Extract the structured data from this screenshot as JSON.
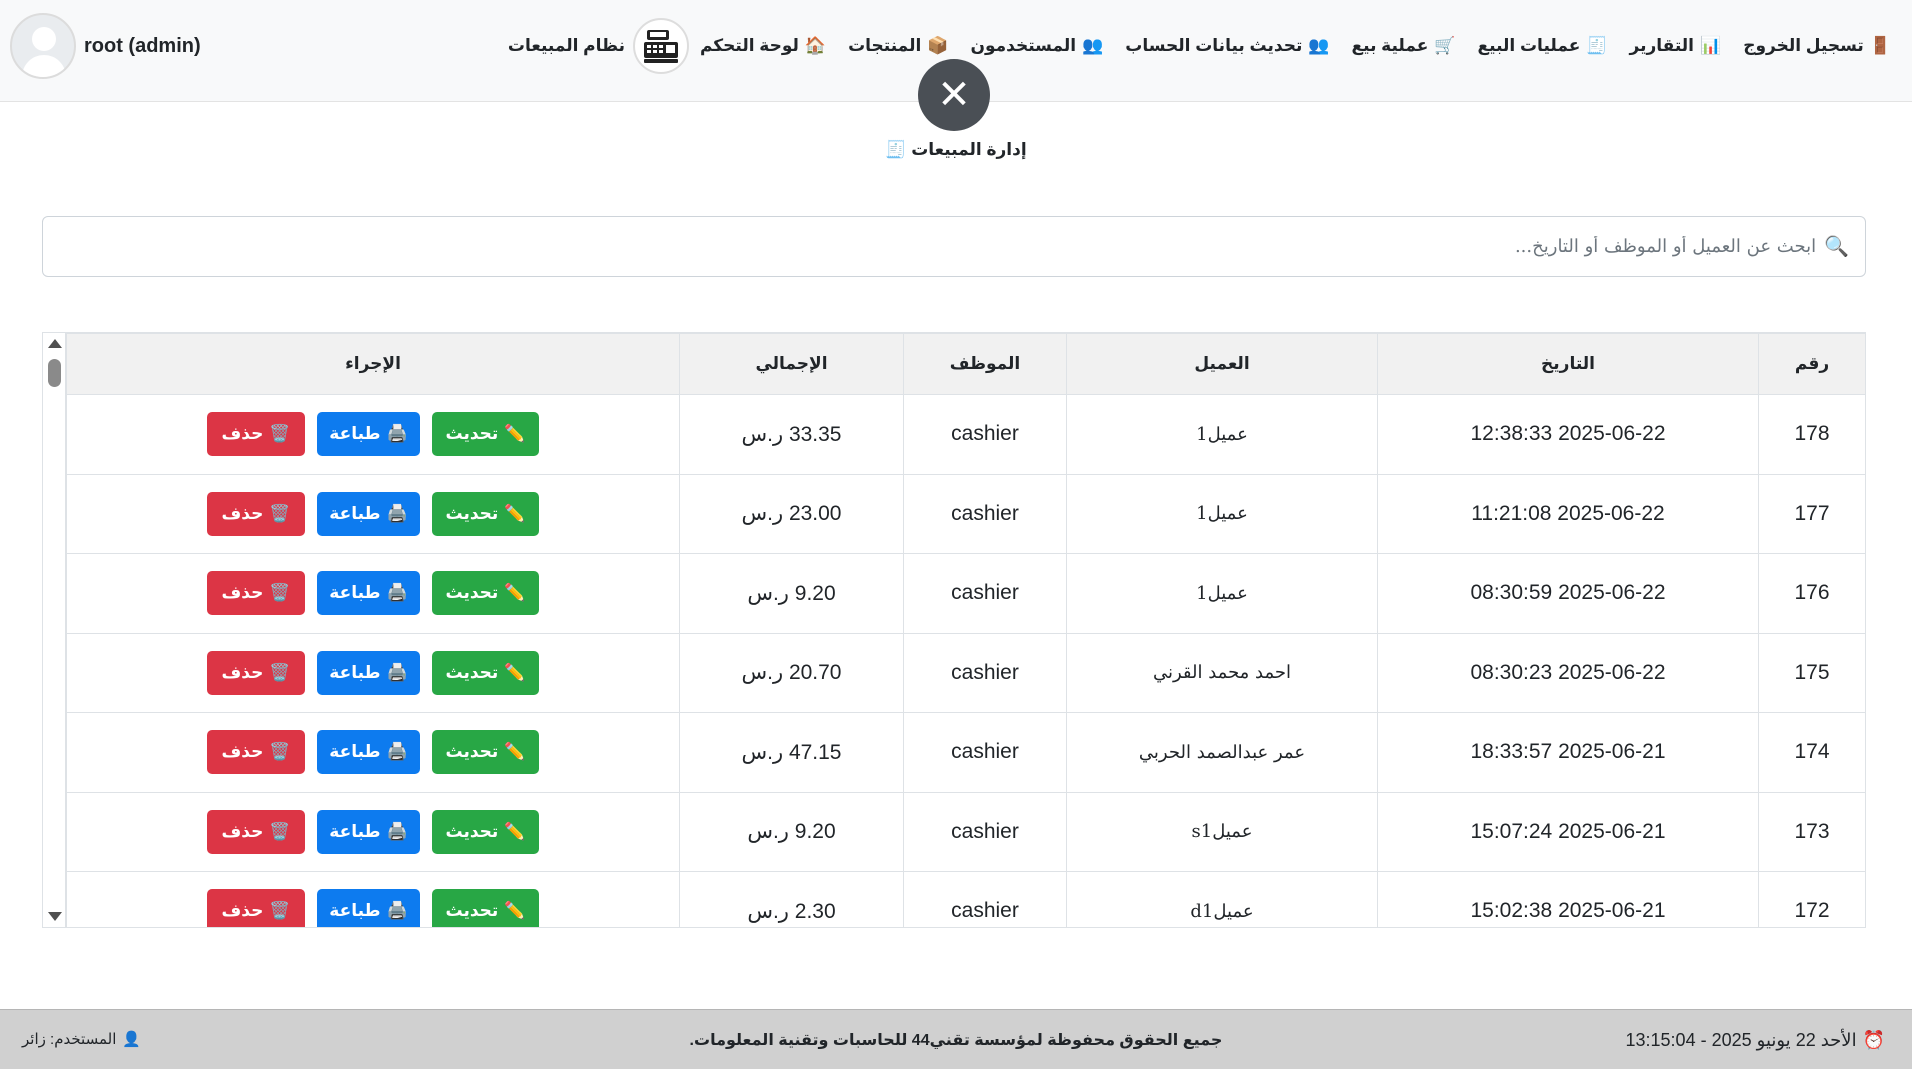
{
  "header": {
    "user_name": "root (admin)",
    "brand": "نظام المبيعات",
    "nav": [
      {
        "label": "لوحة التحكم",
        "icon": "🏠"
      },
      {
        "label": "المنتجات",
        "icon": "📦"
      },
      {
        "label": "المستخدمون",
        "icon": "👥"
      },
      {
        "label": "تحديث بيانات الحساب",
        "icon": "👥"
      },
      {
        "label": "عملية بيع",
        "icon": "🛒"
      },
      {
        "label": "عمليات البيع",
        "icon": "🧾"
      },
      {
        "label": "التقارير",
        "icon": "📊"
      },
      {
        "label": "تسجيل الخروج",
        "icon": "🚪"
      }
    ]
  },
  "close_symbol": "✕",
  "section": {
    "title": "إدارة المبيعات",
    "icon": "🧾"
  },
  "search": {
    "placeholder": "ابحث عن العميل أو الموظف أو التاريخ...",
    "icon": "🔍"
  },
  "table": {
    "headers": {
      "num": "رقم",
      "date": "التاريخ",
      "client": "العميل",
      "employee": "الموظف",
      "total": "الإجمالي",
      "action": "الإجراء"
    },
    "buttons": {
      "update": "تحديث",
      "print": "طباعة",
      "delete": "حذف",
      "update_icon": "✏️",
      "print_icon": "🖨️",
      "delete_icon": "🗑️"
    },
    "rows": [
      {
        "num": "178",
        "date": "2025-06-22 12:38:33",
        "client": "عميل1",
        "employee": "cashier",
        "total": "33.35 ر.س"
      },
      {
        "num": "177",
        "date": "2025-06-22 11:21:08",
        "client": "عميل1",
        "employee": "cashier",
        "total": "23.00 ر.س"
      },
      {
        "num": "176",
        "date": "2025-06-22 08:30:59",
        "client": "عميل1",
        "employee": "cashier",
        "total": "9.20 ر.س"
      },
      {
        "num": "175",
        "date": "2025-06-22 08:30:23",
        "client": "احمد محمد القرني",
        "employee": "cashier",
        "total": "20.70 ر.س"
      },
      {
        "num": "174",
        "date": "2025-06-21 18:33:57",
        "client": "عمر عبدالصمد الحربي",
        "employee": "cashier",
        "total": "47.15 ر.س"
      },
      {
        "num": "173",
        "date": "2025-06-21 15:07:24",
        "client": "عميلs1",
        "employee": "cashier",
        "total": "9.20 ر.س"
      },
      {
        "num": "172",
        "date": "2025-06-21 15:02:38",
        "client": "عميلd1",
        "employee": "cashier",
        "total": "2.30 ر.س"
      }
    ]
  },
  "footer": {
    "datetime": "الأحد 22 يونيو 2025 - 13:15:04",
    "clock_icon": "⏰",
    "copyright": "جميع الحقوق محفوظة لمؤسسة تقني44 للحاسبات وتقنية المعلومات.",
    "user_label": "المستخدم: زائر",
    "user_icon": "👤"
  }
}
